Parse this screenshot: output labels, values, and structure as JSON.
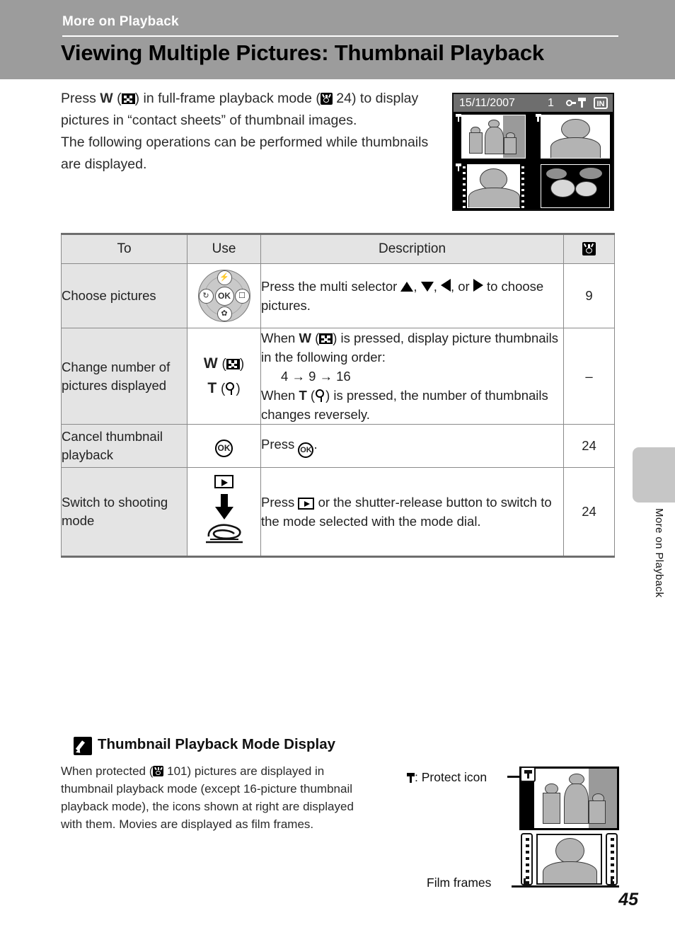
{
  "header": {
    "chapter": "More on Playback",
    "title": "Viewing Multiple Pictures: Thumbnail Playback"
  },
  "intro": {
    "line1_a": "Press ",
    "line1_w": "W",
    "line1_b": " (",
    "line1_c": ") in full-frame playback mode (",
    "line1_pageref": "24",
    "line1_d": ") to display pictures in “contact sheets” of thumbnail images.",
    "line2": "The following operations can be performed while thumbnails are displayed."
  },
  "lcd": {
    "date": "15/11/2007",
    "frame_number": "1",
    "memory_label": "IN"
  },
  "table": {
    "headers": {
      "to": "To",
      "use": "Use",
      "description": "Description",
      "page": "pageref-icon"
    },
    "rows": [
      {
        "to": "Choose pictures",
        "use_icon": "multi-selector-dial",
        "desc_pre": "Press the multi selector ",
        "desc_post": " to choose pictures.",
        "desc_sep1": ", ",
        "desc_sep2": ", ",
        "desc_sep3": ", or ",
        "page": "9"
      },
      {
        "to": "Change number of pictures displayed",
        "use_w": "W",
        "use_t": "T",
        "desc_l1_a": "When ",
        "desc_l1_w": "W",
        "desc_l1_b": " (",
        "desc_l1_c": ") is pressed, display picture thumbnails in the following order:",
        "desc_seq": "4 → 9 → 16",
        "desc_l2_a": "When ",
        "desc_l2_t": "T",
        "desc_l2_b": " (",
        "desc_l2_c": ") is pressed, the number of thumbnails changes reversely.",
        "page": "–"
      },
      {
        "to": "Cancel thumbnail playback",
        "use_icon": "ok-button",
        "use_label": "OK",
        "desc_pre": "Press ",
        "desc_post": ".",
        "page": "24"
      },
      {
        "to": "Switch to shooting mode",
        "use_icon": "playback-button-and-shutter",
        "desc_pre": "Press ",
        "desc_post": " or the shutter-release button to switch to the mode selected with the mode dial.",
        "page": "24"
      }
    ]
  },
  "side_tab": {
    "label": "More on Playback"
  },
  "note": {
    "title": "Thumbnail Playback Mode Display",
    "body_a": "When protected (",
    "body_pageref": "101",
    "body_b": ") pictures are displayed in thumbnail playback mode (except 16-picture thumbnail playback mode), the icons shown at right are displayed with them. Movies are displayed as film frames."
  },
  "diagram": {
    "protect_label": ": Protect icon",
    "film_label": "Film frames"
  },
  "page_number": "45"
}
